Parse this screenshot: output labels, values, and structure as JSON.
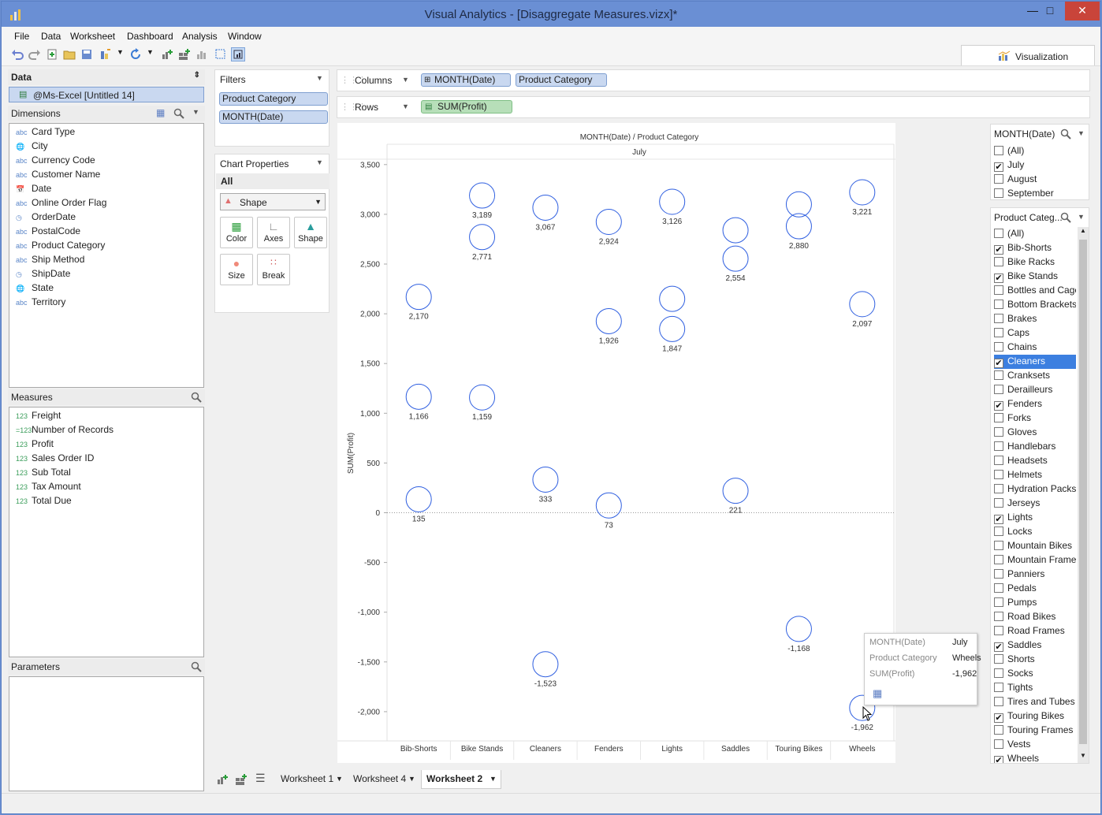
{
  "window": {
    "title": "Visual Analytics - [Disaggregate Measures.vizx]*"
  },
  "menu": [
    "File",
    "Data",
    "Worksheet",
    "Dashboard",
    "Analysis",
    "Window"
  ],
  "vis_tab": {
    "label": "Visualization"
  },
  "data_panel": {
    "title": "Data",
    "source": "@Ms-Excel [Untitled 14]",
    "dimensions_title": "Dimensions",
    "dimensions": [
      {
        "type": "abc",
        "label": "Card Type"
      },
      {
        "type": "geo",
        "label": "City"
      },
      {
        "type": "abc",
        "label": "Currency Code"
      },
      {
        "type": "abc",
        "label": "Customer Name"
      },
      {
        "type": "date",
        "label": "Date"
      },
      {
        "type": "abc",
        "label": "Online Order Flag"
      },
      {
        "type": "datetime",
        "label": "OrderDate"
      },
      {
        "type": "abc",
        "label": "PostalCode"
      },
      {
        "type": "abc",
        "label": "Product Category"
      },
      {
        "type": "abc",
        "label": "Ship Method"
      },
      {
        "type": "datetime",
        "label": "ShipDate"
      },
      {
        "type": "geo",
        "label": "State"
      },
      {
        "type": "abc",
        "label": "Territory"
      }
    ],
    "measures_title": "Measures",
    "measures": [
      {
        "type": "123",
        "label": "Freight"
      },
      {
        "type": "calc",
        "label": "Number of Records"
      },
      {
        "type": "123",
        "label": "Profit"
      },
      {
        "type": "123",
        "label": "Sales Order ID"
      },
      {
        "type": "123",
        "label": "Sub Total"
      },
      {
        "type": "123",
        "label": "Tax Amount"
      },
      {
        "type": "123",
        "label": "Total Due"
      }
    ],
    "parameters_title": "Parameters"
  },
  "filters": {
    "title": "Filters",
    "pills": [
      "Product Category",
      "MONTH(Date)"
    ]
  },
  "chart_properties": {
    "title": "Chart Properties",
    "all_label": "All",
    "mark_type": "Shape",
    "buttons": [
      "Color",
      "Axes",
      "Shape",
      "Size",
      "Break"
    ]
  },
  "shelves": {
    "columns_label": "Columns",
    "columns": [
      "MONTH(Date)",
      "Product Category"
    ],
    "rows_label": "Rows",
    "rows": [
      "SUM(Profit)"
    ]
  },
  "chart_data": {
    "type": "scatter",
    "title": "MONTH(Date) / Product Category",
    "subtitle": "July",
    "ylabel": "SUM(Profit)",
    "ylim": [
      -2400,
      3600
    ],
    "yticks": [
      3500,
      3000,
      2500,
      2000,
      1500,
      1000,
      500,
      0,
      -500,
      -1000,
      -1500,
      -2000
    ],
    "ytick_labels": [
      "3,500",
      "3,000",
      "2,500",
      "2,000",
      "1,500",
      "1,000",
      "500",
      "0",
      "-500",
      "-1,000",
      "-1,500",
      "-2,000"
    ],
    "categories": [
      "Bib-Shorts",
      "Bike Stands",
      "Cleaners",
      "Fenders",
      "Lights",
      "Saddles",
      "Touring Bikes",
      "Wheels"
    ],
    "points": [
      {
        "cat": 0,
        "y": 2170,
        "label": "2,170"
      },
      {
        "cat": 0,
        "y": 1166,
        "label": "1,166"
      },
      {
        "cat": 0,
        "y": 135,
        "label": "135"
      },
      {
        "cat": 1,
        "y": 3189,
        "label": "3,189"
      },
      {
        "cat": 1,
        "y": 2771,
        "label": "2,771"
      },
      {
        "cat": 1,
        "y": 1159,
        "label": "1,159"
      },
      {
        "cat": 2,
        "y": 3067,
        "label": "3,067"
      },
      {
        "cat": 2,
        "y": 333,
        "label": "333"
      },
      {
        "cat": 2,
        "y": -1523,
        "label": "-1,523"
      },
      {
        "cat": 3,
        "y": 2924,
        "label": "2,924"
      },
      {
        "cat": 3,
        "y": 1926,
        "label": "1,926"
      },
      {
        "cat": 3,
        "y": 73,
        "label": "73"
      },
      {
        "cat": 4,
        "y": 3126,
        "label": "3,126"
      },
      {
        "cat": 4,
        "y": 2150,
        "label": ""
      },
      {
        "cat": 4,
        "y": 1847,
        "label": "1,847"
      },
      {
        "cat": 5,
        "y": 2840,
        "label": ""
      },
      {
        "cat": 5,
        "y": 2554,
        "label": "2,554"
      },
      {
        "cat": 5,
        "y": 221,
        "label": "221"
      },
      {
        "cat": 6,
        "y": 3100,
        "label": ""
      },
      {
        "cat": 6,
        "y": 2880,
        "label": "2,880"
      },
      {
        "cat": 6,
        "y": -1168,
        "label": "-1,168"
      },
      {
        "cat": 7,
        "y": 3221,
        "label": "3,221"
      },
      {
        "cat": 7,
        "y": 2097,
        "label": "2,097"
      },
      {
        "cat": 7,
        "y": -1962,
        "label": "-1,962"
      }
    ],
    "marker_color": "#2f5fe0",
    "grid": false
  },
  "tooltip": {
    "rows": [
      {
        "key": "MONTH(Date)",
        "value": "July"
      },
      {
        "key": "Product Category",
        "value": "Wheels"
      },
      {
        "key": "SUM(Profit)",
        "value": "-1,962"
      }
    ]
  },
  "month_filter": {
    "title": "MONTH(Date)",
    "items": [
      {
        "label": "(All)",
        "checked": false
      },
      {
        "label": "July",
        "checked": true
      },
      {
        "label": "August",
        "checked": false
      },
      {
        "label": "September",
        "checked": false
      }
    ]
  },
  "category_filter": {
    "title": "Product Categ...",
    "items": [
      {
        "label": "(All)",
        "checked": false
      },
      {
        "label": "Bib-Shorts",
        "checked": true
      },
      {
        "label": "Bike Racks",
        "checked": false
      },
      {
        "label": "Bike Stands",
        "checked": true
      },
      {
        "label": "Bottles and Cages",
        "checked": false
      },
      {
        "label": "Bottom Brackets",
        "checked": false
      },
      {
        "label": "Brakes",
        "checked": false
      },
      {
        "label": "Caps",
        "checked": false
      },
      {
        "label": "Chains",
        "checked": false
      },
      {
        "label": "Cleaners",
        "checked": true,
        "selected": true
      },
      {
        "label": "Cranksets",
        "checked": false
      },
      {
        "label": "Derailleurs",
        "checked": false
      },
      {
        "label": "Fenders",
        "checked": true
      },
      {
        "label": "Forks",
        "checked": false
      },
      {
        "label": "Gloves",
        "checked": false
      },
      {
        "label": "Handlebars",
        "checked": false
      },
      {
        "label": "Headsets",
        "checked": false
      },
      {
        "label": "Helmets",
        "checked": false
      },
      {
        "label": "Hydration Packs",
        "checked": false
      },
      {
        "label": "Jerseys",
        "checked": false
      },
      {
        "label": "Lights",
        "checked": true
      },
      {
        "label": "Locks",
        "checked": false
      },
      {
        "label": "Mountain Bikes",
        "checked": false
      },
      {
        "label": "Mountain Frames",
        "checked": false
      },
      {
        "label": "Panniers",
        "checked": false
      },
      {
        "label": "Pedals",
        "checked": false
      },
      {
        "label": "Pumps",
        "checked": false
      },
      {
        "label": "Road Bikes",
        "checked": false
      },
      {
        "label": "Road Frames",
        "checked": false
      },
      {
        "label": "Saddles",
        "checked": true
      },
      {
        "label": "Shorts",
        "checked": false
      },
      {
        "label": "Socks",
        "checked": false
      },
      {
        "label": "Tights",
        "checked": false
      },
      {
        "label": "Tires and Tubes",
        "checked": false
      },
      {
        "label": "Touring Bikes",
        "checked": true
      },
      {
        "label": "Touring Frames",
        "checked": false
      },
      {
        "label": "Vests",
        "checked": false
      },
      {
        "label": "Wheels",
        "checked": true
      }
    ]
  },
  "worksheet_tabs": [
    {
      "label": "Worksheet 1",
      "active": false
    },
    {
      "label": "Worksheet 4",
      "active": false
    },
    {
      "label": "Worksheet 2",
      "active": true
    }
  ]
}
